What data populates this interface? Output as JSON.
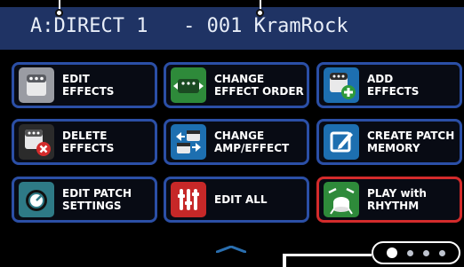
{
  "header": {
    "title": "A:DIRECT 1   - 001 KramRock"
  },
  "buttons": [
    {
      "label": "EDIT\nEFFECTS",
      "icon": "edit-effects-icon",
      "color": "#9a9ca3"
    },
    {
      "label": "CHANGE\nEFFECT ORDER",
      "icon": "change-effect-order-icon",
      "color": "#2e8a3a"
    },
    {
      "label": "ADD\nEFFECTS",
      "icon": "add-effects-icon",
      "color": "#1d6fb0"
    },
    {
      "label": "DELETE\nEFFECTS",
      "icon": "delete-effects-icon",
      "color": "#2b2b2b"
    },
    {
      "label": "CHANGE\nAMP/EFFECT",
      "icon": "change-amp-effect-icon",
      "color": "#1d6fb0"
    },
    {
      "label": "CREATE PATCH\nMEMORY",
      "icon": "create-patch-memory-icon",
      "color": "#1d6fb0"
    },
    {
      "label": "EDIT PATCH\nSETTINGS",
      "icon": "edit-patch-settings-icon",
      "color": "#2e7a86"
    },
    {
      "label": "EDIT ALL",
      "icon": "edit-all-icon",
      "color": "#c62828"
    },
    {
      "label": "PLAY with\nRHYTHM",
      "icon": "play-with-rhythm-icon",
      "color": "#2e8a3a"
    }
  ],
  "pager": {
    "page_count": 4,
    "current_page": 1
  },
  "colors": {
    "header_bg": "#1f3364",
    "button_border": "#2b4fa6",
    "selected_border": "#d42b2b",
    "scroll_arrow": "#2a6fb0"
  }
}
